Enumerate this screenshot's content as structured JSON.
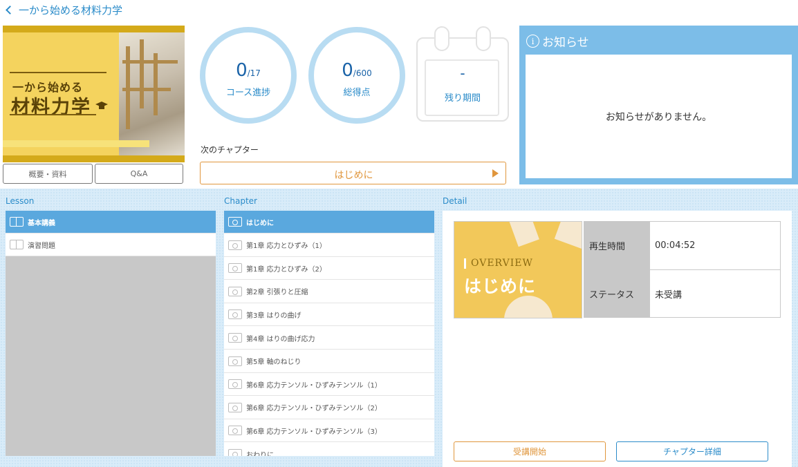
{
  "header": {
    "title": "一から始める材料力学"
  },
  "cover": {
    "line1": "一から始める",
    "line2": "材料力学"
  },
  "side_buttons": {
    "overview": "概要・資料",
    "qa": "Q&A"
  },
  "stats": {
    "progress": {
      "value": "0",
      "total": "/17",
      "label": "コース進捗"
    },
    "score": {
      "value": "0",
      "total": "/600",
      "label": "総得点"
    },
    "period": {
      "value": "-",
      "label": "残り期間"
    }
  },
  "next_chapter": {
    "label": "次のチャプター",
    "button": "はじめに"
  },
  "notice": {
    "title": "お知らせ",
    "icon": "info-icon",
    "message": "お知らせがありません。"
  },
  "lesson": {
    "title": "Lesson",
    "items": [
      {
        "label": "基本講義",
        "selected": true
      },
      {
        "label": "演習問題",
        "selected": false
      }
    ]
  },
  "chapter": {
    "title": "Chapter",
    "items": [
      {
        "label": "はじめに",
        "selected": true
      },
      {
        "label": "第1章 応力とひずみ（1）"
      },
      {
        "label": "第1章 応力とひずみ（2）"
      },
      {
        "label": "第2章 引張りと圧縮"
      },
      {
        "label": "第3章 はりの曲げ"
      },
      {
        "label": "第4章 はりの曲げ応力"
      },
      {
        "label": "第5章 軸のねじり"
      },
      {
        "label": "第6章 応力テンソル・ひずみテンソル（1）"
      },
      {
        "label": "第6章 応力テンソル・ひずみテンソル（2）"
      },
      {
        "label": "第6章 応力テンソル・ひずみテンソル（3）"
      },
      {
        "label": "おわりに"
      }
    ]
  },
  "detail": {
    "title": "Detail",
    "thumb": {
      "overview": "OVERVIEW",
      "title": "はじめに"
    },
    "rows": [
      {
        "key": "再生時間",
        "value": "00:04:52"
      },
      {
        "key": "ステータス",
        "value": "未受講"
      }
    ],
    "start_button": "受講開始",
    "detail_button": "チャプター詳細"
  },
  "colors": {
    "accent": "#2a8bc9",
    "orange": "#e0963c",
    "selected": "#5aa8de",
    "notice": "#7cbde8"
  }
}
